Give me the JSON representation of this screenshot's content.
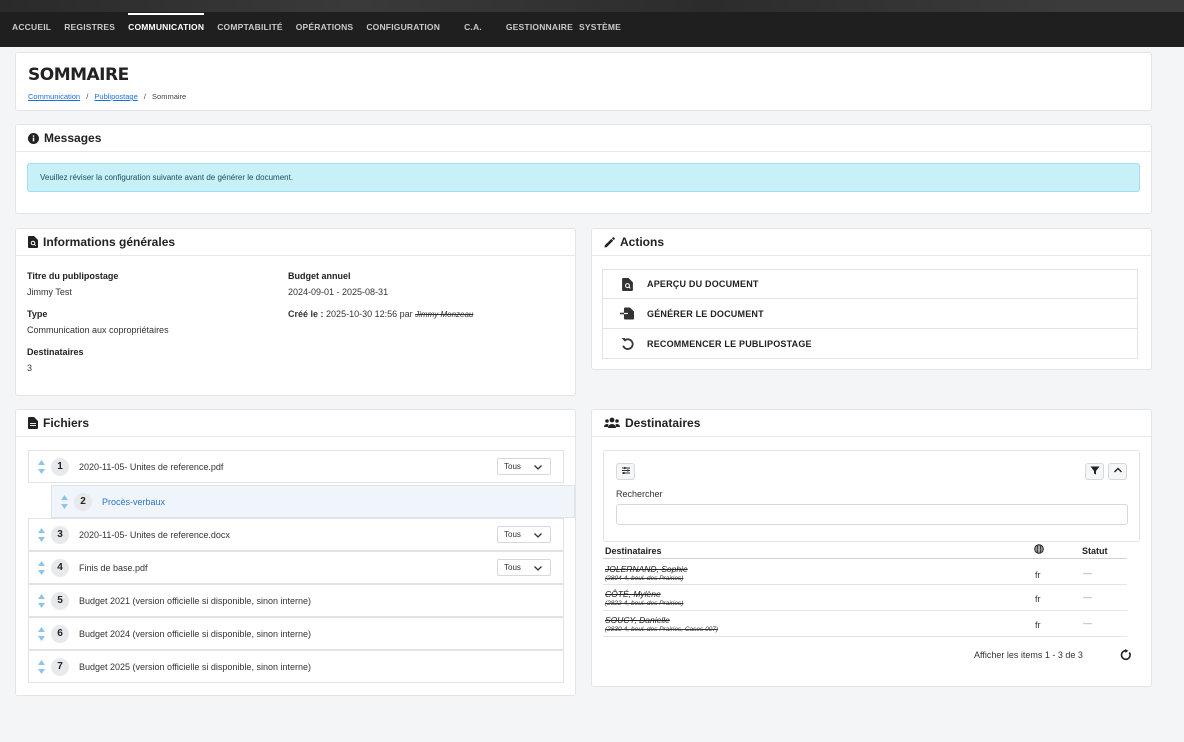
{
  "nav": [
    "ACCUEIL",
    "REGISTRES",
    "COMMUNICATION",
    "COMPTABILITÉ",
    "OPÉRATIONS",
    "CONFIGURATION",
    "C.A.",
    "GESTIONNAIRE",
    "SYSTÈME"
  ],
  "active_nav": "COMMUNICATION",
  "page": {
    "title": "SOMMAIRE",
    "breadcrumb": [
      "Communication",
      "Publipostage",
      "Sommaire"
    ],
    "breadcrumb_sep": "/"
  },
  "messages": {
    "header": "Messages",
    "alert": "Veuillez réviser la configuration suivante avant de générer le document."
  },
  "info": {
    "header": "Informations générales",
    "title_label": "Titre du publipostage",
    "title_value": "Jimmy Test",
    "type_label": "Type",
    "type_value": "Communication aux copropriétaires",
    "recipients_label": "Destinataires",
    "recipients_value": "3",
    "budget_label": "Budget annuel",
    "budget_value": "2024-09-01 - 2025-08-31",
    "created_label": "Créé le :",
    "created_value": "2025-10-30 12:56 par",
    "created_by": "Jimmy Monzeau"
  },
  "actions": {
    "header": "Actions",
    "items": [
      "APERÇU DU DOCUMENT",
      "GÉNÉRER LE DOCUMENT",
      "RECOMMENCER LE PUBLIPOSTAGE"
    ]
  },
  "files": {
    "header": "Fichiers",
    "items": [
      {
        "num": "1",
        "name": "2020-11-05- Unites de reference.pdf",
        "select": "Tous"
      },
      {
        "num": "2",
        "name": "Procès-verbaux",
        "select": ""
      },
      {
        "num": "3",
        "name": "2020-11-05- Unites de reference.docx",
        "select": "Tous"
      },
      {
        "num": "4",
        "name": "Finis de base.pdf",
        "select": "Tous"
      },
      {
        "num": "5",
        "name": "Budget 2021 (version officielle si disponible, sinon interne)",
        "select": ""
      },
      {
        "num": "6",
        "name": "Budget 2024 (version officielle si disponible, sinon interne)",
        "select": ""
      },
      {
        "num": "7",
        "name": "Budget 2025 (version officielle si disponible, sinon interne)",
        "select": ""
      }
    ]
  },
  "recipients": {
    "header": "Destinataires",
    "search_label": "Rechercher",
    "search_value": "",
    "col_name": "Destinataires",
    "col_status": "Statut",
    "rows": [
      {
        "name": "JOLERNAND, Sophie",
        "sub": "(2804-4, boul. des Prairies)",
        "lang": "fr",
        "status": "—"
      },
      {
        "name": "CÔTÉ, Mylène",
        "sub": "(2822-4, boul. des Prairies)",
        "lang": "fr",
        "status": "—"
      },
      {
        "name": "SOUCY, Danielle",
        "sub": "(2830-4, boul. des Prairies, Cases 007)",
        "lang": "fr",
        "status": "—"
      }
    ],
    "pager": "Afficher les items 1 - 3 de 3"
  }
}
